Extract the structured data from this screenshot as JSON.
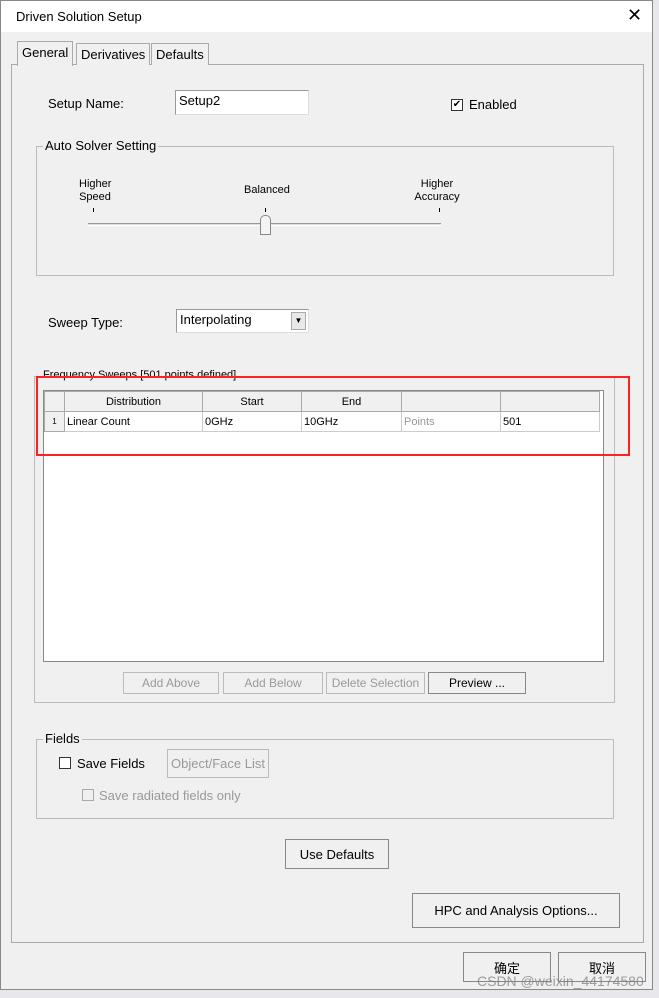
{
  "window": {
    "title": "Driven Solution Setup"
  },
  "tabs": [
    {
      "label": "General",
      "active": true
    },
    {
      "label": "Derivatives"
    },
    {
      "label": "Defaults"
    }
  ],
  "setup_name": {
    "label": "Setup Name:",
    "value": "Setup2"
  },
  "enabled": {
    "label": "Enabled",
    "checked": true
  },
  "auto_solver": {
    "label": "Auto Solver Setting",
    "left": "Higher Speed",
    "middle": "Balanced",
    "right": "Higher Accuracy",
    "position": "Balanced"
  },
  "sweep_type": {
    "label": "Sweep Type:",
    "value": "Interpolating"
  },
  "freq": {
    "label": "Frequency Sweeps [501 points defined]",
    "columns": [
      "",
      "Distribution",
      "Start",
      "End",
      "",
      ""
    ],
    "rows": [
      [
        "1",
        "Linear Count",
        "0GHz",
        "10GHz",
        "Points",
        "501"
      ]
    ]
  },
  "buttons": {
    "add_above": "Add Above",
    "add_below": "Add Below",
    "delete": "Delete Selection",
    "preview": "Preview ...",
    "use_defaults": "Use Defaults",
    "hpc": "HPC and Analysis Options...",
    "ok": "确定",
    "cancel": "取消"
  },
  "fields": {
    "label": "Fields",
    "save_fields": "Save Fields",
    "object_face": "Object/Face List",
    "radiated": "Save radiated fields only"
  },
  "highlight_color": "#ff2020",
  "watermark": "CSDN @weixin_44174580"
}
